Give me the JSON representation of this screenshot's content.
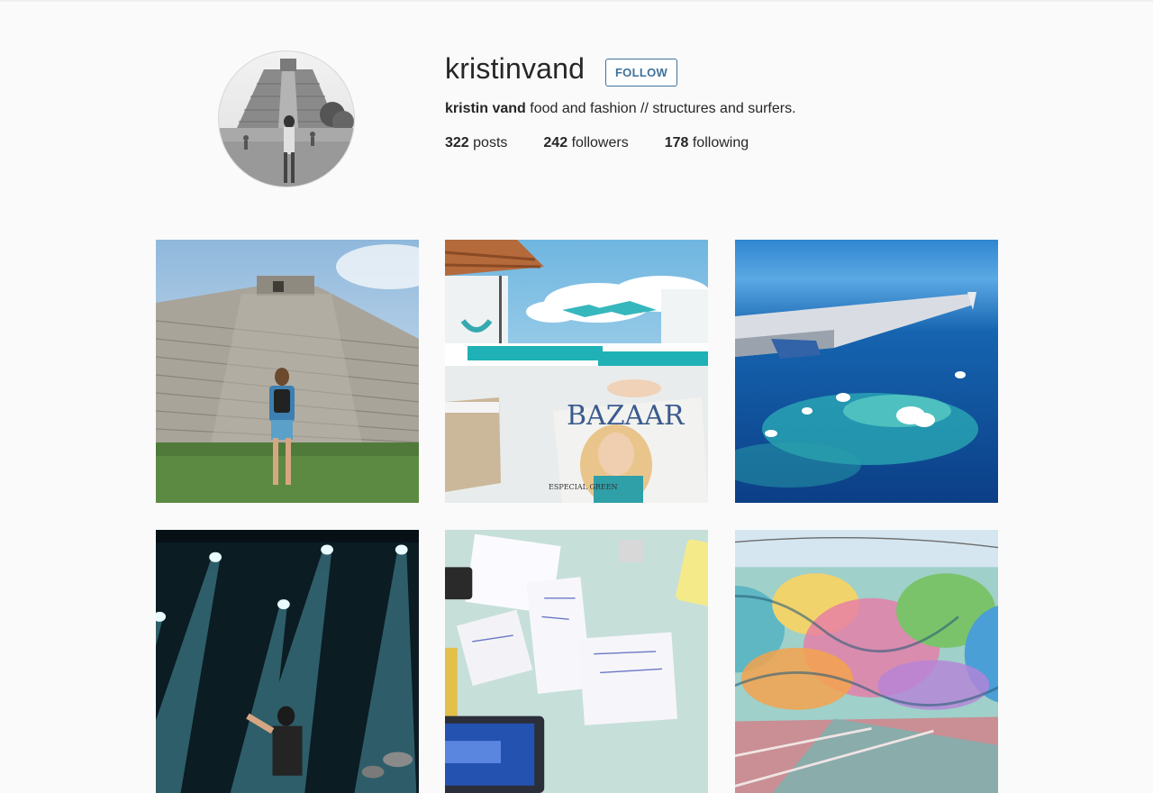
{
  "profile": {
    "username": "kristinvand",
    "follow_label": "FOLLOW",
    "full_name": "kristin vand",
    "bio": "food and fashion // structures and surfers.",
    "avatar_icon": "profile-photo"
  },
  "stats": {
    "posts_count": "322",
    "posts_label": "posts",
    "followers_count": "242",
    "followers_label": "followers",
    "following_count": "178",
    "following_label": "following"
  },
  "posts": [
    {
      "subject": "woman with backpack in front of stone pyramid ruin"
    },
    {
      "subject": "poolside loungers with Bazaar magazine",
      "magazine_title": "BAZAAR",
      "magazine_cover_line": "ESPECIAL GREEN"
    },
    {
      "subject": "airplane wing over turquoise sea"
    },
    {
      "subject": "concert stage with blue spotlights"
    },
    {
      "subject": "desk with laptops and paper notes"
    },
    {
      "subject": "colorful street mural wall"
    }
  ],
  "colors": {
    "background": "#fafafa",
    "text": "#262626",
    "follow_accent": "#3f729b"
  }
}
